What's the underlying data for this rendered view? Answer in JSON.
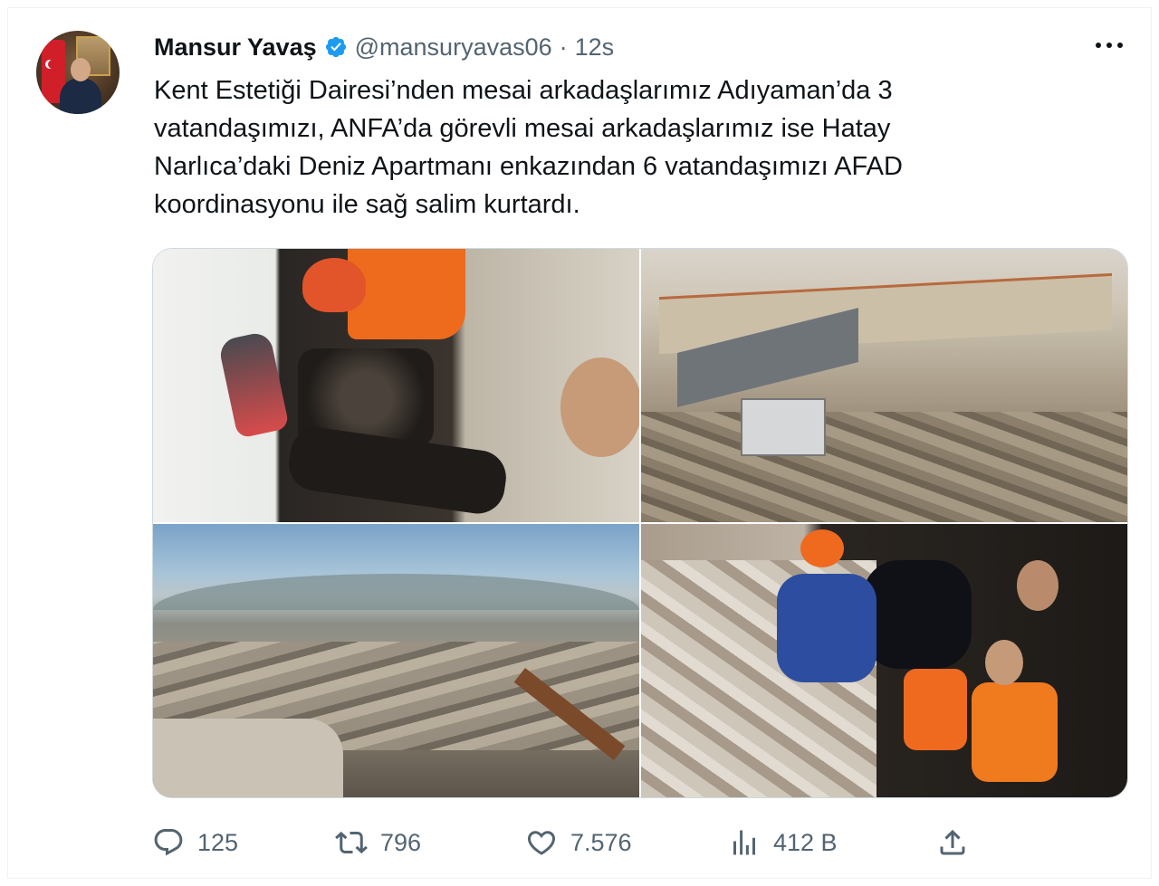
{
  "tweet": {
    "author_name": "Mansur Yavaş",
    "handle": "@mansuryavas06",
    "separator": "·",
    "time": "12s",
    "lines": [
      "Kent Estetiği Dairesi’nden mesai arkadaşlarımız Adıyaman’da 3",
      "vatandaşımızı, ANFA’da görevli mesai arkadaşlarımız ise Hatay",
      "Narlıca’daki Deniz Apartmanı enkazından 6 vatandaşımızı AFAD",
      "koordinasyonu ile sağ salim kurtardı."
    ]
  },
  "stats": {
    "replies": "125",
    "retweets": "796",
    "likes": "7.576",
    "views": "412 B"
  },
  "icons": {
    "verified": "verified-badge-icon",
    "more": "more-icon",
    "reply": "reply-icon",
    "retweet": "retweet-icon",
    "like": "heart-icon",
    "views": "views-icon",
    "share": "share-icon"
  },
  "colors": {
    "text": "#0f1419",
    "secondary": "#536471",
    "verified": "#1d9bf0"
  }
}
